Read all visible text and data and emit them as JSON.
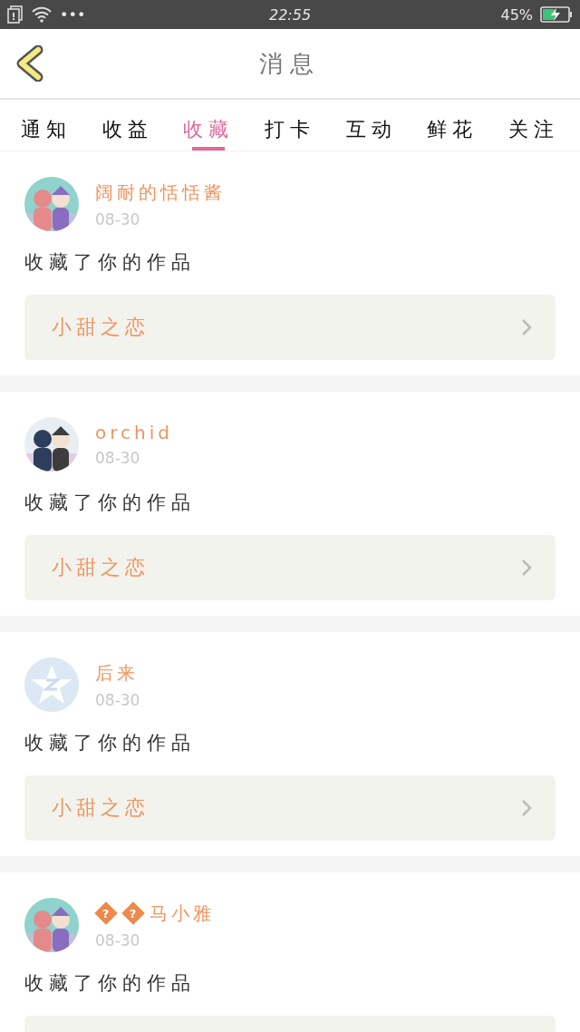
{
  "status_bar": {
    "time": "22:55",
    "battery_percent": "45%",
    "more": "•••",
    "charging": true
  },
  "header": {
    "title": "消息"
  },
  "tabs": [
    {
      "label": "通知",
      "selected": false
    },
    {
      "label": "收益",
      "selected": false
    },
    {
      "label": "收藏",
      "selected": true
    },
    {
      "label": "打卡",
      "selected": false
    },
    {
      "label": "互动",
      "selected": false
    },
    {
      "label": "鲜花",
      "selected": false
    },
    {
      "label": "关注",
      "selected": false
    }
  ],
  "messages": [
    {
      "name": "阔耐的恬恬酱",
      "date": "08-30",
      "text": "收藏了你的作品",
      "work": {
        "kind": "full",
        "title": "小甜之恋"
      }
    },
    {
      "name": "orchid",
      "date": "08-30",
      "text": "收藏了你的作品",
      "work": {
        "kind": "full",
        "title": "小甜之恋"
      }
    },
    {
      "avatar": {
        "kind": "default"
      },
      "name": "后来",
      "date": "08-30",
      "text": "收藏了你的作品",
      "work": {
        "kind": "full",
        "title": "小甜之恋"
      }
    },
    {
      "name_badges": [
        "?",
        "?"
      ],
      "name": "马小雅",
      "date": "08-30",
      "text": "收藏了你的作品",
      "work": {
        "kind": "cut"
      }
    }
  ]
}
